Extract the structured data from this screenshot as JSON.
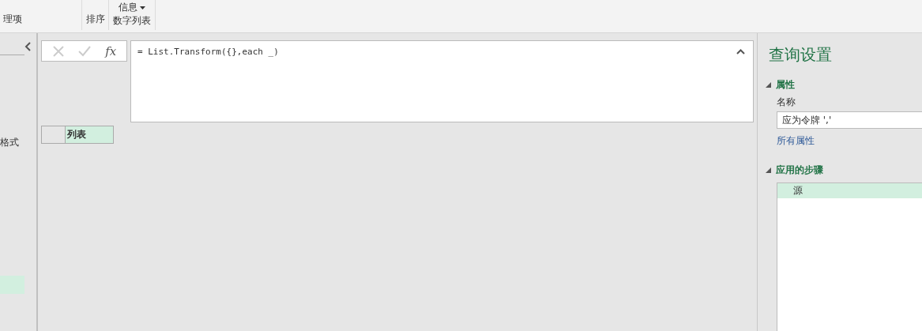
{
  "ribbon": {
    "top_button": {
      "label": "信息"
    },
    "groups": [
      {
        "label": "理项"
      },
      {
        "label": "排序"
      },
      {
        "label": "数字列表"
      }
    ]
  },
  "left_panel": {
    "items": [
      {
        "label": "格式",
        "selected": false
      },
      {
        "selected": true
      }
    ]
  },
  "formula_bar": {
    "fx_label": "fx",
    "formula": "= List.Transform({},each _)"
  },
  "table": {
    "columns": [
      {
        "label": "列表",
        "selected": true
      }
    ]
  },
  "query_settings": {
    "title": "查询设置",
    "properties": {
      "heading": "属性",
      "name_label": "名称",
      "name_value": "应为令牌 ',' ",
      "all_properties_link": "所有属性"
    },
    "steps": {
      "heading": "应用的步骤",
      "items": [
        {
          "label": "源",
          "selected": true
        }
      ]
    }
  }
}
